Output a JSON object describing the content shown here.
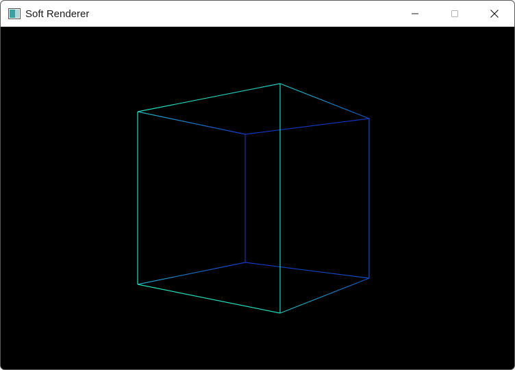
{
  "window": {
    "title": "Soft Renderer",
    "icon": "app-window-icon",
    "controls": [
      {
        "name": "minimize",
        "icon": "minimize-icon"
      },
      {
        "name": "maximize",
        "icon": "maximize-icon",
        "disabled": true
      },
      {
        "name": "close",
        "icon": "close-icon"
      }
    ]
  },
  "viewport": {
    "background": "#000000",
    "render": "wireframe-cube",
    "colors": {
      "front": "#20e0b8",
      "back": "#1438c8",
      "mid": "#1870d0"
    }
  }
}
